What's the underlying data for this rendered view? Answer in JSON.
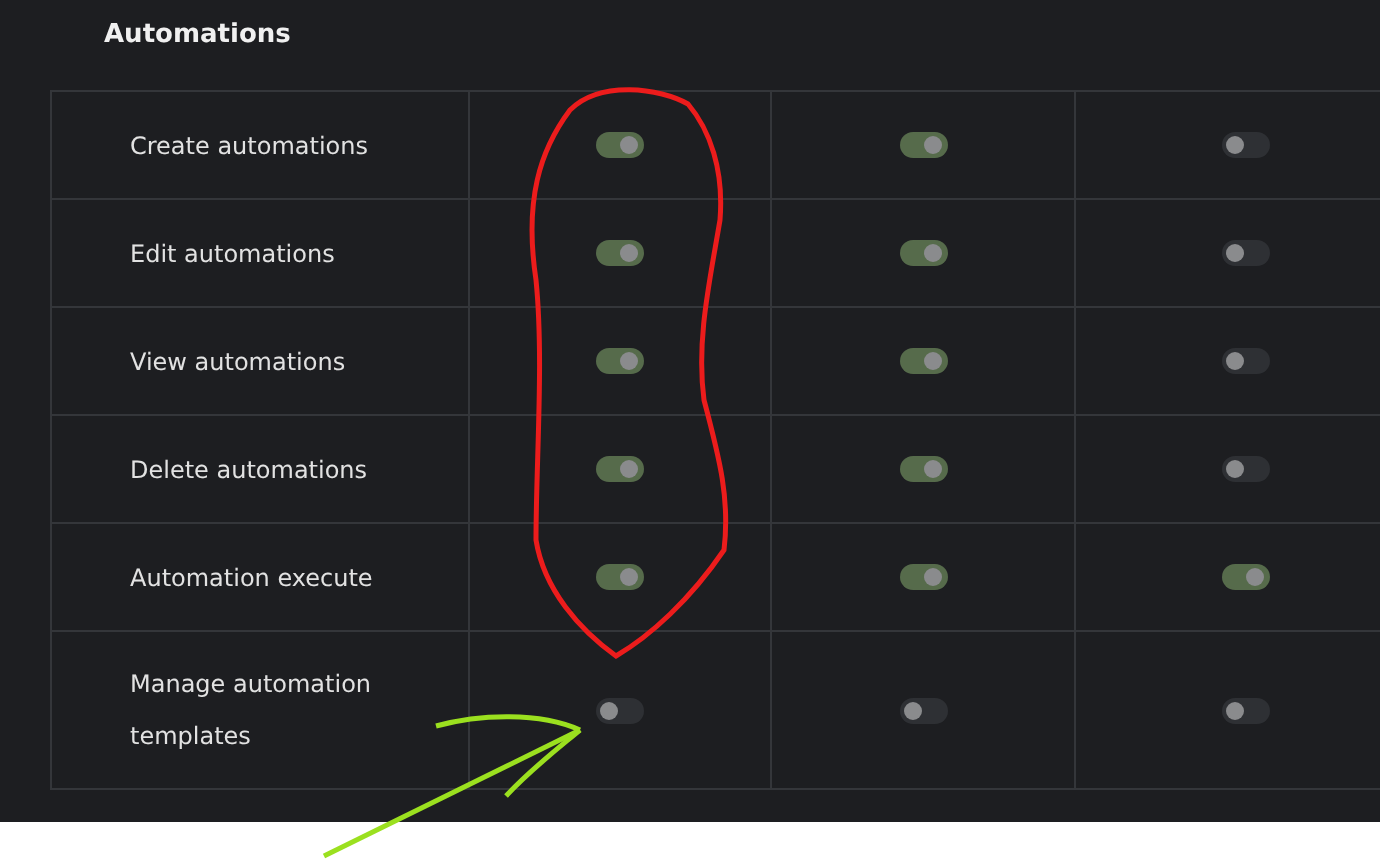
{
  "section": {
    "title": "Automations"
  },
  "rows": [
    {
      "label": "Create automations",
      "toggles": [
        {
          "on": true
        },
        {
          "on": true
        },
        {
          "on": false
        }
      ]
    },
    {
      "label": "Edit automations",
      "toggles": [
        {
          "on": true
        },
        {
          "on": true
        },
        {
          "on": false
        }
      ]
    },
    {
      "label": "View automations",
      "toggles": [
        {
          "on": true
        },
        {
          "on": true
        },
        {
          "on": false
        }
      ]
    },
    {
      "label": "Delete automations",
      "toggles": [
        {
          "on": true
        },
        {
          "on": true
        },
        {
          "on": false
        }
      ]
    },
    {
      "label": "Automation execute",
      "toggles": [
        {
          "on": true
        },
        {
          "on": true
        },
        {
          "on": true
        }
      ]
    },
    {
      "label": "Manage automation templates",
      "toggles": [
        {
          "on": false
        },
        {
          "on": false
        },
        {
          "on": false
        }
      ]
    }
  ]
}
